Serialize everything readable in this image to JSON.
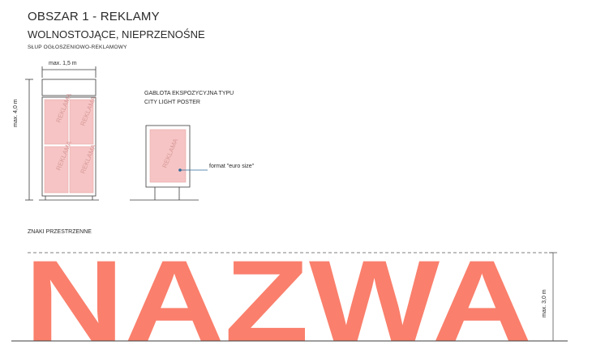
{
  "header": {
    "title": "OBSZAR 1 - REKLAMY",
    "subtitle": "WOLNOSTOJĄCE, NIEPRZENOŚNE"
  },
  "column_section": {
    "label": "SŁUP OGŁOSZENIOWO-REKLAMOWY",
    "width_dim": "max. 1,5 m",
    "height_dim": "max. 4,0 m",
    "panel_text": "REKLAMA"
  },
  "showcase_section": {
    "label_line1": "GABLOTA EKSPOZYCYJNA TYPU",
    "label_line2": "CITY LIGHT POSTER",
    "panel_text": "REKLAMA",
    "format_note": "format \"euro size\""
  },
  "spatial_section": {
    "label": "ZNAKI PRZESTRZENNE",
    "sign_text": "NAZWA",
    "height_dim": "max. 3,0 m"
  },
  "colors": {
    "panel_fill": "#f6c4c4",
    "sign_fill": "#fa7f6c",
    "line": "#3c3c3c",
    "accent": "#2e6b9a"
  }
}
